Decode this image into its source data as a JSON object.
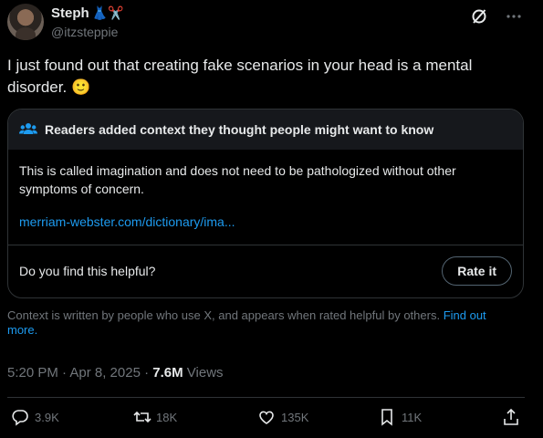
{
  "author": {
    "name": "Steph",
    "name_emoji": "👗✂️",
    "handle": "@itzsteppie"
  },
  "tweet": {
    "text": "I just found out that creating fake scenarios in your head is a mental disorder.",
    "emoji": "🙂"
  },
  "note": {
    "header": "Readers added context they thought people might want to know",
    "body": "This is called imagination and does not need to be pathologized without other symptoms of concern.",
    "link": "merriam-webster.com/dictionary/ima...",
    "helpful_question": "Do you find this helpful?",
    "rate_label": "Rate it"
  },
  "context_disclaimer": {
    "text": "Context is written by people who use X, and appears when rated helpful by others.",
    "link": "Find out more."
  },
  "meta": {
    "time_date": "5:20 PM · Apr 8, 2025 · ",
    "views_count": "7.6M",
    "views_label": " Views"
  },
  "actions": {
    "replies": "3.9K",
    "reposts": "18K",
    "likes": "135K",
    "bookmarks": "11K"
  },
  "colors": {
    "background": "#000000",
    "link": "#1d9bf0",
    "muted": "#71767b",
    "border": "#2f3336"
  },
  "icons": [
    "grok-icon",
    "more-icon",
    "community-notes-icon",
    "reply-icon",
    "repost-icon",
    "like-icon",
    "bookmark-icon",
    "share-icon"
  ]
}
